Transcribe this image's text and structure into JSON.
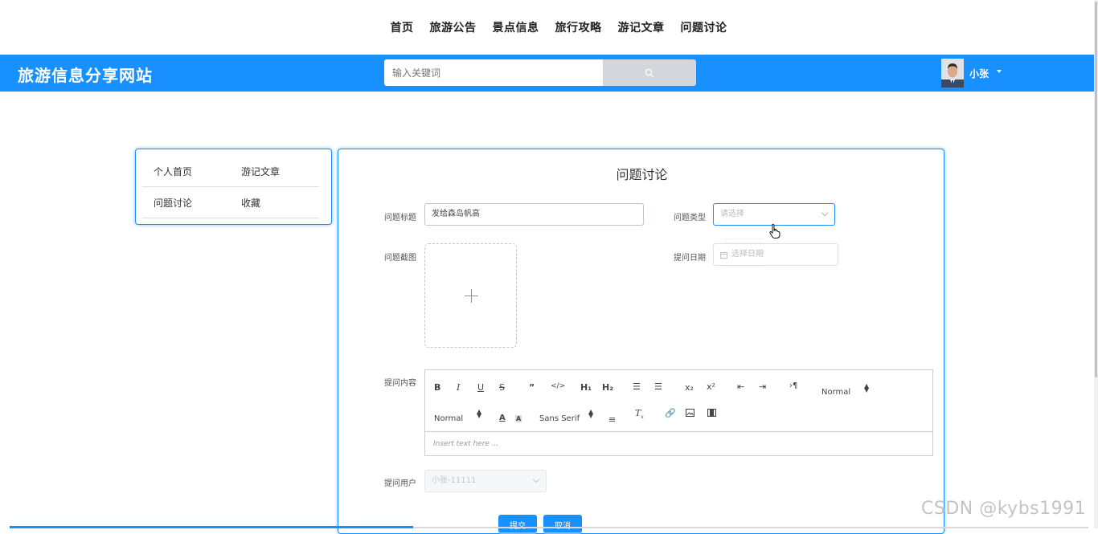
{
  "nav": {
    "items": [
      "首页",
      "旅游公告",
      "景点信息",
      "旅行攻略",
      "游记文章",
      "问题讨论"
    ]
  },
  "header": {
    "site_title": "旅游信息分享网站",
    "search_placeholder": "输入关键词",
    "user_name": "小张"
  },
  "sidebar": {
    "items": [
      "个人首页",
      "游记文章",
      "问题讨论",
      "收藏"
    ]
  },
  "form": {
    "title": "问题讨论",
    "question_title_label": "问题标题",
    "question_title_value": "发给森岛帆高",
    "question_type_label": "问题类型",
    "question_type_placeholder": "请选择",
    "screenshot_label": "问题截图",
    "date_label": "提问日期",
    "date_placeholder": "选择日期",
    "content_label": "提问内容",
    "editor": {
      "header_select": "Normal",
      "size_select": "Normal",
      "font_select": "Sans Serif",
      "placeholder": "Insert text here ..."
    },
    "user_label": "提问用户",
    "user_value": "小张-11111",
    "submit_label": "提交",
    "cancel_label": "取消"
  },
  "watermark": "CSDN @kybs1991",
  "colors": {
    "primary": "#1890ff"
  }
}
